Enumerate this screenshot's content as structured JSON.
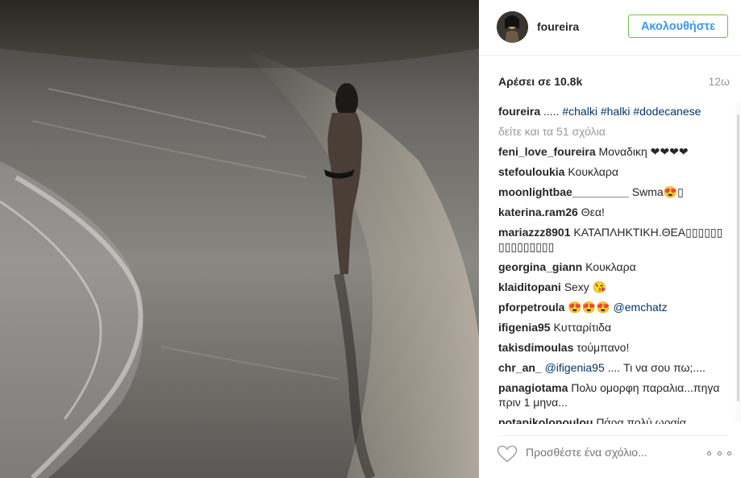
{
  "post": {
    "username": "foureira",
    "follow_label": "Ακολουθήστε",
    "likes": "Αρέσει σε 10.8k",
    "time_ago": "12ω",
    "caption": {
      "user": "foureira",
      "text": "..... ",
      "tags": [
        "#chalki",
        "#halki",
        "#dodecanese"
      ]
    },
    "view_all": "δείτε και τα 51 σχόλια",
    "add_comment_placeholder": "Προσθέστε ένα σχόλιο..."
  },
  "comments": [
    {
      "user": "feni_love_foureira",
      "text": "Μοναδικη ❤❤❤❤"
    },
    {
      "user": "stefouloukia",
      "text": "Κουκλαρα"
    },
    {
      "user": "moonlightbae_________",
      "text": "Swma😍▯"
    },
    {
      "user": "katerina.ram26",
      "text": "Θεα!"
    },
    {
      "user": "mariazzz8901",
      "text": "ΚΑΤΑΠΛΗΚΤΙΚΗ.ΘΕΑ▯▯▯▯▯▯▯▯▯▯▯▯▯▯▯"
    },
    {
      "user": "georgina_giann",
      "text": "Κουκλαρα"
    },
    {
      "user": "klaiditopani",
      "text": "Sexy 😘"
    },
    {
      "user": "pforpetroula",
      "text": "😍😍😍",
      "mention": "@emchatz",
      "after": ""
    },
    {
      "user": "ifigenia95",
      "text": "Κυτταρίτιδα"
    },
    {
      "user": "takisdimoulas",
      "text": "τούμπανο!"
    },
    {
      "user": "chr_an_",
      "text": "",
      "mention": "@ifigenia95",
      "after": ".... Τι να σου πω;...."
    },
    {
      "user": "panagiotama",
      "text": "Πολυ ομορφη παραλια...πηγα πριν 1 μηνα..."
    },
    {
      "user": "potapikolopoulou",
      "text": "Πάρα πολύ ωραία"
    }
  ],
  "colors": {
    "link": "#003569",
    "follow_text": "#3897f0",
    "follow_border": "#70c050",
    "muted": "#999999"
  },
  "icons": {
    "like": "heart-outline-icon",
    "more": "three-dots-icon"
  }
}
